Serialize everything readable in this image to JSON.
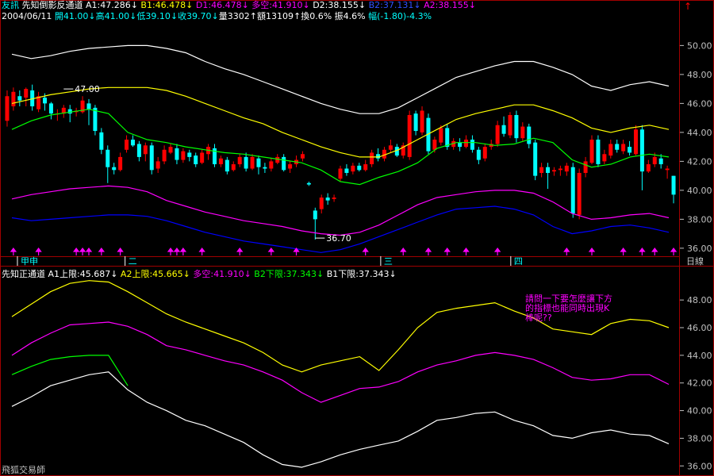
{
  "header": {
    "line1": [
      {
        "text": "友訊",
        "color": "#00ffff"
      },
      {
        "text": " 先知倒影反通道 ",
        "color": "#ffffff"
      },
      {
        "text": "A1:47.286↓",
        "color": "#ffffff"
      },
      {
        "text": " B1:46.478↓",
        "color": "#ffff00"
      },
      {
        "text": " D1:46.478↓",
        "color": "#ff00ff"
      },
      {
        "text": " 多空:41.910↓",
        "color": "#ff00ff"
      },
      {
        "text": " D2:38.155↓",
        "color": "#ffffff"
      },
      {
        "text": " B2:37.131↓",
        "color": "#3050ff"
      },
      {
        "text": " A2:38.155↓",
        "color": "#ff00ff"
      }
    ],
    "line2": [
      {
        "text": "2004/06/11",
        "color": "#ffffff"
      },
      {
        "text": " 開41.00↓",
        "color": "#00ffff"
      },
      {
        "text": "高41.00↓",
        "color": "#00ffff"
      },
      {
        "text": "低39.10↓",
        "color": "#00ffff"
      },
      {
        "text": "收39.70↓",
        "color": "#00ffff"
      },
      {
        "text": "量3302↑",
        "color": "#ffffff"
      },
      {
        "text": "額13109↑",
        "color": "#ffffff"
      },
      {
        "text": "換0.6%",
        "color": "#ffffff"
      },
      {
        "text": " 振4.6%",
        "color": "#ffffff"
      },
      {
        "text": " 幅(-1.80)-4.3%",
        "color": "#00ffff"
      }
    ],
    "lower": [
      {
        "text": "先知正通道 ",
        "color": "#ffffff"
      },
      {
        "text": "A1上限:45.687↓",
        "color": "#ffffff"
      },
      {
        "text": " A2上限:45.665↓",
        "color": "#ffff00"
      },
      {
        "text": " 多空:41.910↓",
        "color": "#ff00ff"
      },
      {
        "text": " B2下限:37.343↓",
        "color": "#00ff00"
      },
      {
        "text": " B1下限:37.343↓",
        "color": "#ffffff"
      }
    ]
  },
  "note": "請問一下要怎麼讓下方的指標也能同時出現K棒呢??",
  "watermark": "飛狐交易師",
  "scroll_arrow": "↑",
  "timeframe": "日線",
  "colors": {
    "up": "#ff0000",
    "down": "#00ffff",
    "frame": "#a00000",
    "axis": "#c0c0c0",
    "white": "#ffffff",
    "magenta": "#ff00ff",
    "green": "#00ff00",
    "blue": "#0000ff",
    "yellow": "#ffff00"
  },
  "chart_data": [
    {
      "type": "candlestick",
      "title": "先知倒影反通道",
      "ylim": [
        35.5,
        51.5
      ],
      "yticks": [
        "36.00",
        "38.00",
        "40.00",
        "42.00",
        "44.00",
        "46.00",
        "48.00",
        "50.00"
      ],
      "month_labels": [
        "甲申",
        "二",
        "三",
        "四"
      ],
      "annotations": [
        {
          "text": "47.00",
          "x": 9
        },
        {
          "text": "36.70",
          "x": 49
        }
      ],
      "candles": [
        [
          44.8,
          46.5,
          46.9,
          44.4
        ],
        [
          45.8,
          46.8,
          47.1,
          45.5
        ],
        [
          46.5,
          46.2,
          46.9,
          45.8
        ],
        [
          46.4,
          47.0,
          47.1,
          45.8
        ],
        [
          46.9,
          45.8,
          47.3,
          45.5
        ],
        [
          45.6,
          46.5,
          46.8,
          45.4
        ],
        [
          46.4,
          46.0,
          46.7,
          45.5
        ],
        [
          46.0,
          45.3,
          46.1,
          44.9
        ],
        [
          45.3,
          45.3,
          45.6,
          44.8
        ],
        [
          45.3,
          45.7,
          45.9,
          45.0
        ],
        [
          45.6,
          45.3,
          45.9,
          44.7
        ],
        [
          45.4,
          45.5,
          45.7,
          45.1
        ],
        [
          45.4,
          46.2,
          46.5,
          45.3
        ],
        [
          46.0,
          45.6,
          46.3,
          44.5
        ],
        [
          45.7,
          44.1,
          45.9,
          43.8
        ],
        [
          44.0,
          42.8,
          44.3,
          42.5
        ],
        [
          42.8,
          41.6,
          43.1,
          40.5
        ],
        [
          41.6,
          41.4,
          41.9,
          41.1
        ],
        [
          41.4,
          42.3,
          42.6,
          41.3
        ],
        [
          42.8,
          43.5,
          43.8,
          42.6
        ],
        [
          43.5,
          43.1,
          43.8,
          43.0
        ],
        [
          43.2,
          42.3,
          43.4,
          42.0
        ],
        [
          42.5,
          43.1,
          43.3,
          42.0
        ],
        [
          43.1,
          41.4,
          43.3,
          41.1
        ],
        [
          41.5,
          42.0,
          42.3,
          41.2
        ],
        [
          42.0,
          42.8,
          43.1,
          41.8
        ],
        [
          42.6,
          43.0,
          43.2,
          42.5
        ],
        [
          42.9,
          42.1,
          43.2,
          41.8
        ],
        [
          42.1,
          42.7,
          42.9,
          41.9
        ],
        [
          42.6,
          42.3,
          42.8,
          42.0
        ],
        [
          42.4,
          41.8,
          42.6,
          41.6
        ],
        [
          41.9,
          42.6,
          42.8,
          41.8
        ],
        [
          42.5,
          43.0,
          43.2,
          42.1
        ],
        [
          42.9,
          41.8,
          43.2,
          41.6
        ],
        [
          41.8,
          42.2,
          42.4,
          41.6
        ],
        [
          42.1,
          41.3,
          42.3,
          41.1
        ],
        [
          41.4,
          41.8,
          42.0,
          41.3
        ],
        [
          41.8,
          42.3,
          42.5,
          41.6
        ],
        [
          42.3,
          41.5,
          42.6,
          41.3
        ],
        [
          41.5,
          42.3,
          42.5,
          41.4
        ],
        [
          42.2,
          41.6,
          42.4,
          41.1
        ],
        [
          41.6,
          41.5,
          41.9,
          41.2
        ],
        [
          41.5,
          42.0,
          42.2,
          41.3
        ],
        [
          41.9,
          42.3,
          42.5,
          41.8
        ],
        [
          42.3,
          41.4,
          42.5,
          41.3
        ],
        [
          41.5,
          41.8,
          42.0,
          41.2
        ],
        [
          41.8,
          42.1,
          42.4,
          41.6
        ],
        [
          42.2,
          42.5,
          42.7,
          42.0
        ],
        [
          40.5,
          40.4,
          40.6,
          40.3
        ],
        [
          38.6,
          38.0,
          38.8,
          36.6
        ],
        [
          38.7,
          39.5,
          39.7,
          38.4
        ],
        [
          39.5,
          39.3,
          39.8,
          39.0
        ],
        [
          39.4,
          39.5,
          39.7,
          39.2
        ],
        [
          40.8,
          41.5,
          41.7,
          40.6
        ],
        [
          41.5,
          41.2,
          41.8,
          41.0
        ],
        [
          41.3,
          41.7,
          41.9,
          41.1
        ],
        [
          41.7,
          41.4,
          41.9,
          41.3
        ],
        [
          41.4,
          41.8,
          42.1,
          41.3
        ],
        [
          41.8,
          42.6,
          42.8,
          41.6
        ],
        [
          42.5,
          42.2,
          42.9,
          42.0
        ],
        [
          42.2,
          42.8,
          43.0,
          42.0
        ],
        [
          42.8,
          43.1,
          43.5,
          42.6
        ],
        [
          43.0,
          42.4,
          43.2,
          42.3
        ],
        [
          42.4,
          43.1,
          43.3,
          42.2
        ],
        [
          42.3,
          45.2,
          45.5,
          42.1
        ],
        [
          45.3,
          44.1,
          45.5,
          43.8
        ],
        [
          44.0,
          45.5,
          45.8,
          43.8
        ],
        [
          45.0,
          42.7,
          45.3,
          42.5
        ],
        [
          42.8,
          43.5,
          43.7,
          42.6
        ],
        [
          43.3,
          44.3,
          44.5,
          43.1
        ],
        [
          44.3,
          43.0,
          44.6,
          42.8
        ],
        [
          43.0,
          43.4,
          43.6,
          42.8
        ],
        [
          43.3,
          43.0,
          43.6,
          42.7
        ],
        [
          43.0,
          43.5,
          43.8,
          42.9
        ],
        [
          43.5,
          42.8,
          43.8,
          42.6
        ],
        [
          42.8,
          42.1,
          43.0,
          41.8
        ],
        [
          42.2,
          43.0,
          43.2,
          42.0
        ],
        [
          43.0,
          43.2,
          43.5,
          42.8
        ],
        [
          43.2,
          44.5,
          44.8,
          43.0
        ],
        [
          44.5,
          43.9,
          45.1,
          43.7
        ],
        [
          43.8,
          45.2,
          45.4,
          43.6
        ],
        [
          45.2,
          43.6,
          45.5,
          43.3
        ],
        [
          43.6,
          44.4,
          44.7,
          43.4
        ],
        [
          44.4,
          43.2,
          44.6,
          42.9
        ],
        [
          43.3,
          41.0,
          43.5,
          40.7
        ],
        [
          41.2,
          41.6,
          41.9,
          40.9
        ],
        [
          41.6,
          41.2,
          41.9,
          40.1
        ],
        [
          41.3,
          41.4,
          41.6,
          41.0
        ],
        [
          41.4,
          41.5,
          41.7,
          41.0
        ],
        [
          41.3,
          41.7,
          41.9,
          41.0
        ],
        [
          41.6,
          38.4,
          41.9,
          38.1
        ],
        [
          38.3,
          41.2,
          41.5,
          38.0
        ],
        [
          41.2,
          42.0,
          42.3,
          40.9
        ],
        [
          41.9,
          43.5,
          43.8,
          41.8
        ],
        [
          43.5,
          41.8,
          43.8,
          41.6
        ],
        [
          42.0,
          42.5,
          42.8,
          41.8
        ],
        [
          42.4,
          43.2,
          43.5,
          42.2
        ],
        [
          43.2,
          42.8,
          43.5,
          42.6
        ],
        [
          42.7,
          43.2,
          43.5,
          42.5
        ],
        [
          43.0,
          42.6,
          43.4,
          42.4
        ],
        [
          42.5,
          44.2,
          44.5,
          42.4
        ],
        [
          44.2,
          41.3,
          44.5,
          40.0
        ],
        [
          41.3,
          41.8,
          42.1,
          41.2
        ],
        [
          41.8,
          42.3,
          42.6,
          41.6
        ],
        [
          42.2,
          41.8,
          42.5,
          41.5
        ],
        [
          41.4,
          41.5,
          41.7,
          40.8
        ],
        [
          41.0,
          39.7,
          41.0,
          39.1
        ]
      ],
      "series": [
        {
          "color": "#ffffff",
          "values": [
            49.4,
            49.1,
            49.3,
            49.6,
            49.8,
            49.9,
            50.0,
            50.0,
            49.8,
            49.5,
            48.9,
            48.4,
            48.0,
            47.5,
            47.0,
            46.5,
            46.0,
            45.6,
            45.3,
            45.3,
            45.7,
            46.4,
            47.1,
            47.8,
            48.2,
            48.6,
            48.9,
            48.9,
            48.5,
            48.0,
            47.2,
            46.9,
            47.3,
            47.5,
            47.2
          ]
        },
        {
          "color": "#ffff00",
          "values": [
            46.0,
            46.3,
            46.6,
            46.8,
            47.0,
            47.1,
            47.1,
            47.1,
            46.9,
            46.5,
            46.0,
            45.5,
            45.0,
            44.6,
            44.0,
            43.5,
            43.0,
            42.6,
            42.3,
            42.3,
            42.8,
            43.5,
            44.2,
            44.9,
            45.3,
            45.6,
            45.9,
            45.9,
            45.5,
            45.0,
            44.3,
            44.0,
            44.3,
            44.5,
            44.2
          ]
        },
        {
          "color": "#00ff00",
          "values": [
            44.2,
            44.8,
            45.2,
            45.4,
            45.6,
            45.3,
            44.0,
            43.5,
            43.3,
            43.0,
            42.8,
            42.6,
            42.5,
            42.3,
            42.1,
            41.9,
            41.4,
            40.6,
            40.4,
            40.9,
            41.3,
            41.9,
            42.9,
            43.3,
            43.3,
            43.1,
            43.2,
            43.6,
            43.3,
            42.1,
            41.6,
            41.8,
            42.3,
            42.5,
            42.3
          ]
        },
        {
          "color": "#ff00ff",
          "values": [
            39.4,
            39.7,
            39.9,
            40.1,
            40.2,
            40.3,
            40.2,
            39.9,
            39.3,
            38.9,
            38.5,
            38.2,
            37.9,
            37.7,
            37.5,
            37.2,
            37.0,
            36.9,
            37.1,
            37.6,
            38.3,
            39.0,
            39.5,
            39.7,
            39.9,
            40.0,
            40.0,
            39.8,
            39.2,
            38.4,
            38.0,
            38.1,
            38.3,
            38.4,
            38.1
          ]
        },
        {
          "color": "#0000ff",
          "values": [
            38.1,
            37.9,
            38.0,
            38.1,
            38.2,
            38.3,
            38.3,
            38.2,
            37.9,
            37.5,
            37.1,
            36.8,
            36.5,
            36.3,
            36.1,
            35.9,
            35.7,
            35.9,
            36.3,
            36.8,
            37.3,
            37.8,
            38.3,
            38.7,
            38.8,
            38.9,
            38.7,
            38.3,
            37.5,
            37.0,
            37.2,
            37.5,
            37.6,
            37.4,
            37.1
          ]
        }
      ]
    },
    {
      "type": "line",
      "title": "先知正通道",
      "ylim": [
        35.5,
        49.5
      ],
      "yticks": [
        "36.00",
        "38.00",
        "40.00",
        "42.00",
        "44.00",
        "46.00",
        "48.00"
      ],
      "series": [
        {
          "name": "A1上限",
          "color": "#ffff00",
          "values": [
            46.8,
            47.7,
            48.6,
            49.2,
            49.4,
            49.3,
            48.6,
            47.8,
            47.0,
            46.4,
            45.9,
            45.4,
            44.9,
            44.2,
            43.3,
            42.8,
            43.3,
            43.6,
            43.9,
            42.9,
            44.4,
            46.0,
            47.1,
            47.4,
            47.6,
            47.8,
            47.2,
            46.7,
            45.9,
            45.7,
            45.5,
            46.3,
            46.6,
            46.5,
            46.0
          ]
        },
        {
          "name": "多空",
          "color": "#ff00ff",
          "values": [
            44.0,
            44.9,
            45.6,
            46.2,
            46.3,
            46.4,
            46.1,
            45.5,
            44.7,
            44.4,
            44.0,
            43.6,
            43.3,
            42.8,
            42.2,
            41.3,
            40.6,
            41.1,
            41.6,
            41.7,
            42.1,
            42.8,
            43.3,
            43.6,
            44.0,
            44.2,
            44.0,
            43.7,
            43.1,
            42.4,
            42.2,
            42.3,
            42.6,
            42.6,
            41.9
          ]
        },
        {
          "name": "B2下限",
          "color": "#00ff00",
          "values": [
            42.6,
            43.2,
            43.7,
            43.9,
            44.0,
            44.0,
            41.8
          ]
        },
        {
          "name": "B1下限",
          "color": "#ffffff",
          "values": [
            40.3,
            41.0,
            41.8,
            42.2,
            42.6,
            42.8,
            41.5,
            40.6,
            40.0,
            39.3,
            38.9,
            38.3,
            37.7,
            36.8,
            36.1,
            35.9,
            36.3,
            36.8,
            37.2,
            37.5,
            37.8,
            38.5,
            39.3,
            39.5,
            39.8,
            39.9,
            39.3,
            38.9,
            38.2,
            38.0,
            38.4,
            38.6,
            38.3,
            38.2,
            37.6
          ]
        }
      ]
    }
  ]
}
